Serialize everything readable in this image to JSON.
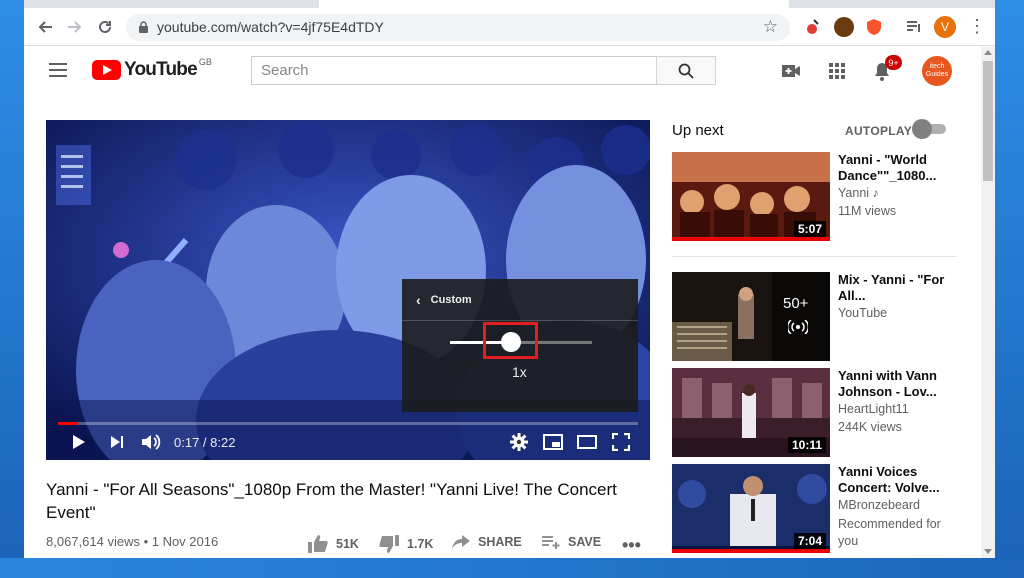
{
  "browser": {
    "url": "youtube.com/watch?v=4jf75E4dTDY",
    "profile_initial": "V"
  },
  "header": {
    "logo_text": "YouTube",
    "region": "GB",
    "search_placeholder": "Search",
    "notification_count": "9+",
    "channel_avatar_line1": "itech",
    "channel_avatar_line2": "Guides"
  },
  "player": {
    "speed_menu_title": "Custom",
    "speed_value": "1x",
    "time_display": "0:17 / 8:22",
    "progress_fraction": 0.034
  },
  "video": {
    "title": "Yanni - \"For All Seasons\"_1080p From the Master! \"Yanni Live! The Concert Event\"",
    "views_date": "8,067,614 views • 1 Nov 2016",
    "likes": "51K",
    "dislikes": "1.7K",
    "share_label": "SHARE",
    "save_label": "SAVE"
  },
  "sidebar": {
    "up_next_label": "Up next",
    "autoplay_label": "AUTOPLAY",
    "items": [
      {
        "title": "Yanni - \"World Dance\"\"_1080...",
        "channel": "Yanni ♪",
        "meta": "11M views",
        "duration": "5:07"
      },
      {
        "title": "Mix - Yanni - \"For All...",
        "channel": "YouTube",
        "meta": "",
        "duration": "",
        "count": "50+"
      },
      {
        "title": "Yanni with Vann Johnson - Lov...",
        "channel": "HeartLight11",
        "meta": "244K views",
        "duration": "10:11"
      },
      {
        "title": "Yanni Voices Concert: Volve...",
        "channel": "MBronzebeard",
        "meta": "Recommended for you",
        "duration": "7:04"
      }
    ]
  },
  "colors": {
    "brand_red": "#ff0000",
    "highlight_box": "#e02020"
  }
}
